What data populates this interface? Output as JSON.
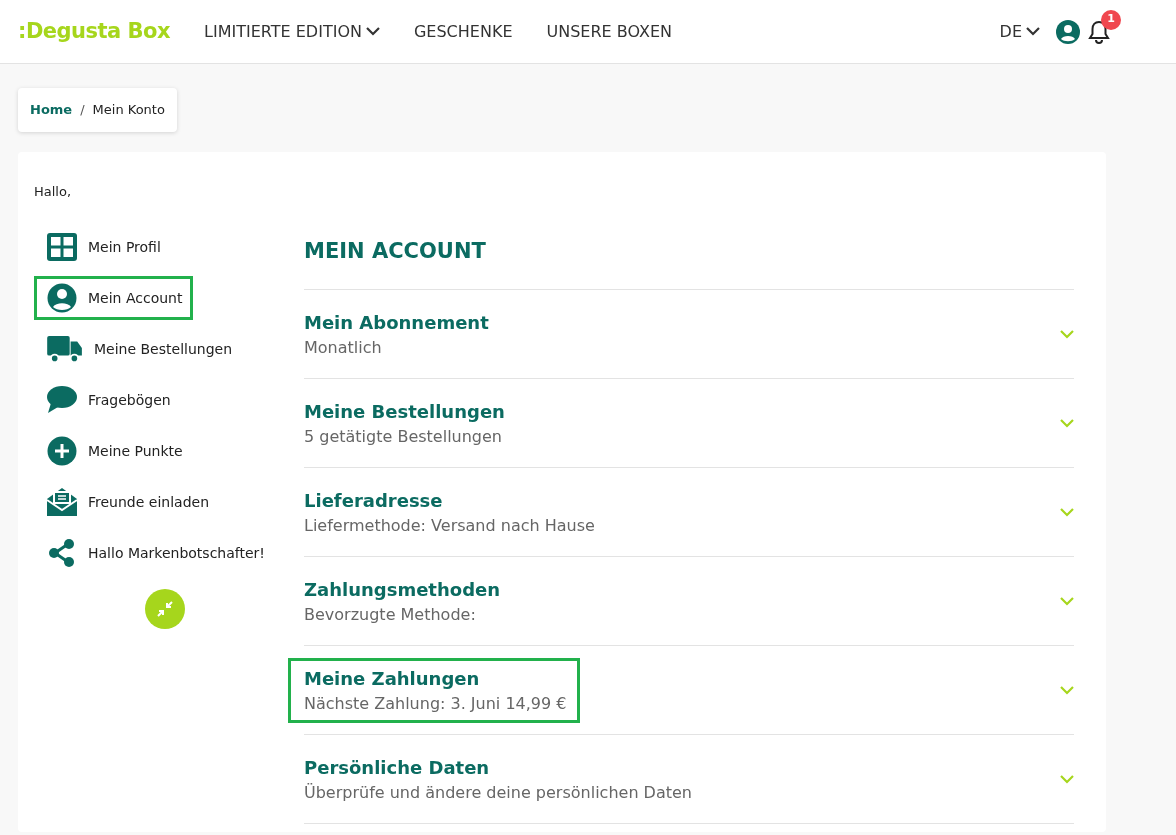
{
  "header": {
    "logo": ":Degusta Box",
    "nav": [
      {
        "label": "LIMITIERTE EDITION",
        "dropdown": true
      },
      {
        "label": "GESCHENKE",
        "dropdown": false
      },
      {
        "label": "UNSERE BOXEN",
        "dropdown": false
      }
    ],
    "language": "DE",
    "notification_count": "1"
  },
  "breadcrumb": [
    "Home",
    "Mein Konto"
  ],
  "breadcrumb_separator": "/",
  "greeting": "Hallo,",
  "sidebar": {
    "items": [
      {
        "label": "Mein Profil",
        "selected": false
      },
      {
        "label": "Mein Account",
        "selected": true
      },
      {
        "label": "Meine Bestellungen",
        "selected": false
      },
      {
        "label": "Fragebögen",
        "selected": false
      },
      {
        "label": "Meine Punkte",
        "selected": false
      },
      {
        "label": "Freunde einladen",
        "selected": false
      },
      {
        "label": "Hallo Markenbotschafter!",
        "selected": false
      }
    ]
  },
  "section_title": "MEIN ACCOUNT",
  "sections": [
    {
      "title": "Mein Abonnement",
      "subtitle": "Monatlich",
      "highlighted": false
    },
    {
      "title": "Meine Bestellungen",
      "subtitle": "5 getätigte Bestellungen",
      "highlighted": false
    },
    {
      "title": "Lieferadresse",
      "subtitle": "Liefermethode: Versand nach Hause",
      "highlighted": false
    },
    {
      "title": "Zahlungsmethoden",
      "subtitle": "Bevorzugte Methode:",
      "highlighted": false
    },
    {
      "title": "Meine Zahlungen",
      "subtitle": "Nächste Zahlung: 3. Juni 14,99 €",
      "highlighted": true
    },
    {
      "title": "Persönliche Daten",
      "subtitle": "Überprüfe und ändere deine persönlichen Daten",
      "highlighted": false
    }
  ]
}
